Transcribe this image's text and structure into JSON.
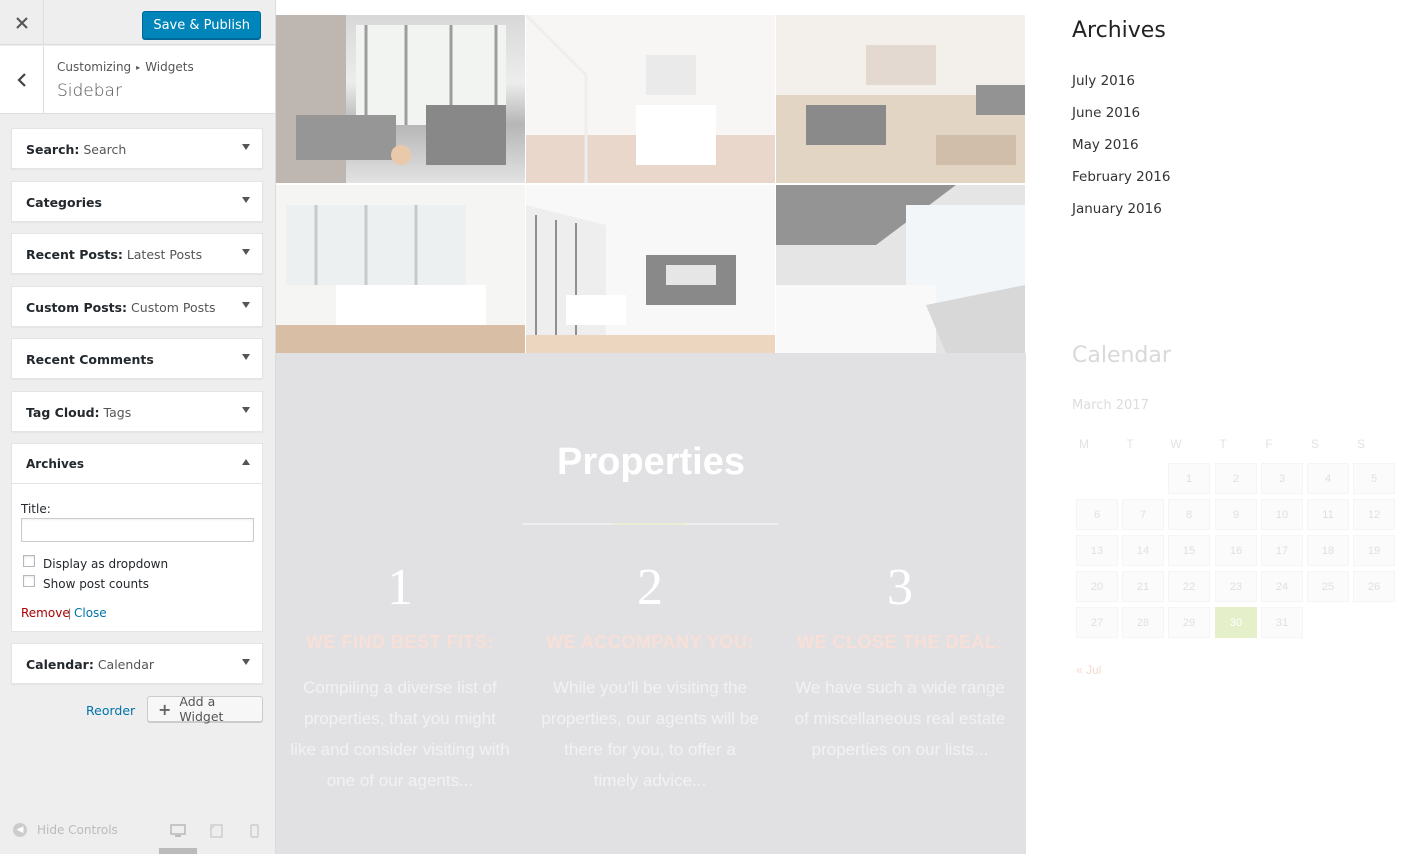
{
  "customizer": {
    "save_label": "Save & Publish",
    "breadcrumb": [
      "Customizing",
      "Widgets"
    ],
    "section_title": "Sidebar",
    "widgets": [
      {
        "type": "Search:",
        "sub": "Search"
      },
      {
        "type": "Categories",
        "sub": ""
      },
      {
        "type": "Recent Posts:",
        "sub": "Latest Posts"
      },
      {
        "type": "Custom Posts:",
        "sub": "Custom Posts"
      },
      {
        "type": "Recent Comments",
        "sub": ""
      },
      {
        "type": "Tag Cloud:",
        "sub": "Tags"
      }
    ],
    "archives_widget": {
      "title": "Archives",
      "title_label": "Title:",
      "title_value": "",
      "checkbox_dropdown": "Display as dropdown",
      "checkbox_counts": "Show post counts",
      "remove_label": "Remove",
      "separator": "|",
      "close_label": "Close"
    },
    "calendar_widget": {
      "type": "Calendar:",
      "sub": "Calendar"
    },
    "reorder_label": "Reorder",
    "add_widget_label": "Add a Widget",
    "hide_controls_label": "Hide Controls"
  },
  "preview": {
    "properties_title": "Properties",
    "steps": [
      {
        "num": "1",
        "heading": "WE FIND BEST FITS:",
        "body": "Compiling a diverse list of properties, that you might like and consider visiting with one of our agents..."
      },
      {
        "num": "2",
        "heading": "WE ACCOMPANY YOU:",
        "body": "While you'll be visiting the properties, our agents will be there for you, to offer a timely advice..."
      },
      {
        "num": "3",
        "heading": "WE CLOSE THE DEAL:",
        "body": "We have such a wide range of miscellaneous real estate properties on our lists..."
      }
    ],
    "archives_title": "Archives",
    "archives": [
      "July 2016",
      "June 2016",
      "May 2016",
      "February 2016",
      "January 2016"
    ],
    "calendar_title": "Calendar",
    "calendar_month": "March 2017",
    "calendar_dow": [
      "M",
      "T",
      "W",
      "T",
      "F",
      "S",
      "S"
    ],
    "calendar_weeks": [
      [
        "",
        "",
        "1",
        "2",
        "3",
        "4",
        "5"
      ],
      [
        "6",
        "7",
        "8",
        "9",
        "10",
        "11",
        "12"
      ],
      [
        "13",
        "14",
        "15",
        "16",
        "17",
        "18",
        "19"
      ],
      [
        "20",
        "21",
        "22",
        "23",
        "24",
        "25",
        "26"
      ],
      [
        "27",
        "28",
        "29",
        "30",
        "31",
        "",
        ""
      ]
    ],
    "calendar_today": "30",
    "calendar_prev": "« Jul"
  },
  "colors": {
    "primary_button": "#0085ba",
    "remove_link": "#aa0000",
    "link": "#0073aa",
    "band": "#d6d6d9",
    "step_heading": "#f6d3c8"
  }
}
